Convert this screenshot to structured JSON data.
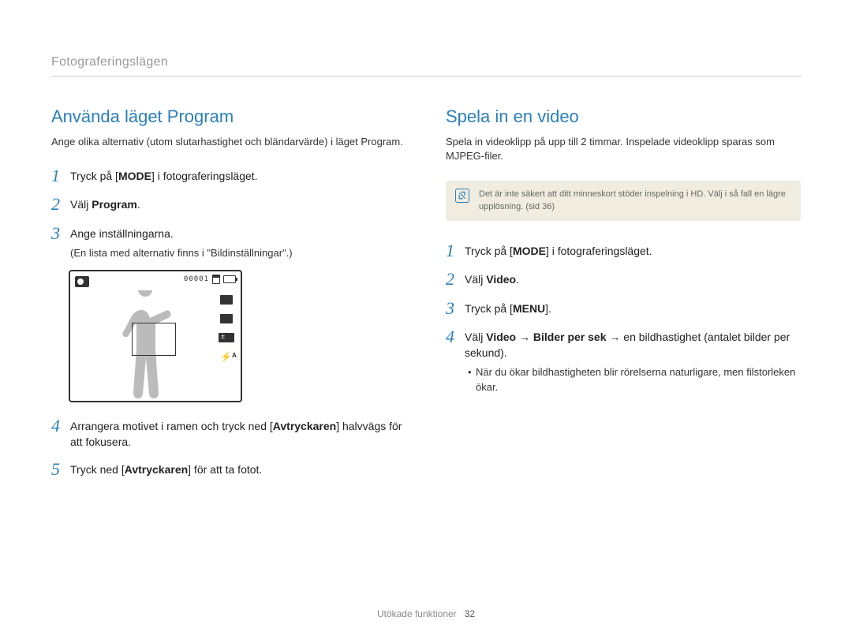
{
  "breadcrumb": "Fotograferingslägen",
  "left": {
    "title": "Använda läget Program",
    "intro": "Ange olika alternativ (utom slutarhastighet och bländarvärde) i läget Program.",
    "steps": {
      "s1": {
        "num": "1",
        "pre": "Tryck på [",
        "bold": "MODE",
        "post": "] i fotograferingsläget."
      },
      "s2": {
        "num": "2",
        "pre": "Välj ",
        "bold": "Program",
        "post": "."
      },
      "s3": {
        "num": "3",
        "line1": "Ange inställningarna.",
        "line2": "(En lista med alternativ finns i \"Bildinställningar\".)"
      },
      "s4": {
        "num": "4",
        "pre": "Arrangera motivet i ramen och tryck ned [",
        "bold": "Avtryckaren",
        "post": "] halvvägs för att fokusera."
      },
      "s5": {
        "num": "5",
        "pre": "Tryck ned [",
        "bold": "Avtryckaren",
        "post": "] för att ta fotot."
      }
    },
    "lcd": {
      "counter": "00001"
    }
  },
  "right": {
    "title": "Spela in en video",
    "intro": "Spela in videoklipp på upp till 2 timmar. Inspelade videoklipp sparas som MJPEG-filer.",
    "note": "Det är inte säkert att ditt minneskort stöder inspelning i HD. Välj i så fall en lägre upplösning. (sid 36)",
    "steps": {
      "s1": {
        "num": "1",
        "pre": "Tryck på [",
        "bold": "MODE",
        "post": "] i fotograferingsläget."
      },
      "s2": {
        "num": "2",
        "pre": "Välj ",
        "bold": "Video",
        "post": "."
      },
      "s3": {
        "num": "3",
        "pre": "Tryck på [",
        "bold": "MENU",
        "post": "]."
      },
      "s4": {
        "num": "4",
        "pre": "Välj ",
        "bold1": "Video",
        "arrow": " → ",
        "bold2": "Bilder per sek",
        "post": " → en bildhastighet (antalet bilder per sekund).",
        "bullet": "När du ökar bildhastigheten blir rörelserna naturligare, men filstorleken ökar."
      }
    }
  },
  "footer": {
    "label": "Utökade funktioner",
    "page": "32"
  }
}
